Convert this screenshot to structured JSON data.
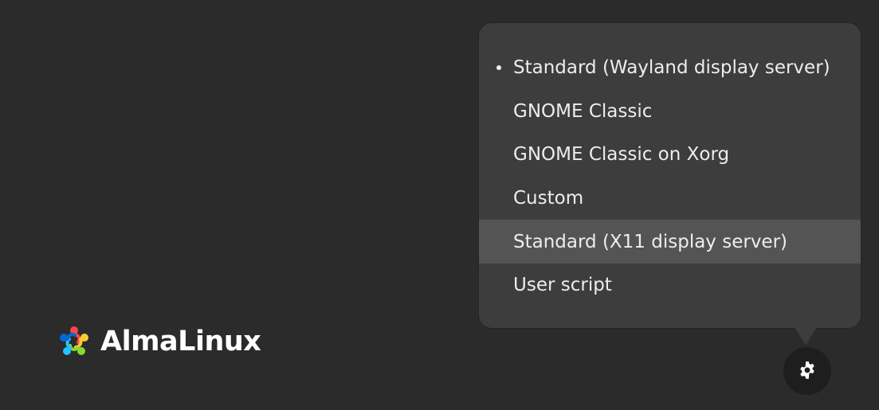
{
  "brand": {
    "name": "AlmaLinux"
  },
  "session_menu": {
    "items": [
      {
        "label": "Standard (Wayland display server)",
        "selected": true
      },
      {
        "label": "GNOME Classic",
        "selected": false
      },
      {
        "label": "GNOME Classic on Xorg",
        "selected": false
      },
      {
        "label": "Custom",
        "selected": false
      },
      {
        "label": "Standard (X11 display server)",
        "selected": false,
        "highlighted": true
      },
      {
        "label": "User script",
        "selected": false
      }
    ]
  },
  "settings_button": {
    "icon": "gear-icon"
  },
  "colors": {
    "background": "#2b2b2b",
    "popover": "#3d3d3d",
    "hover": "#545454",
    "text": "#ededed"
  }
}
